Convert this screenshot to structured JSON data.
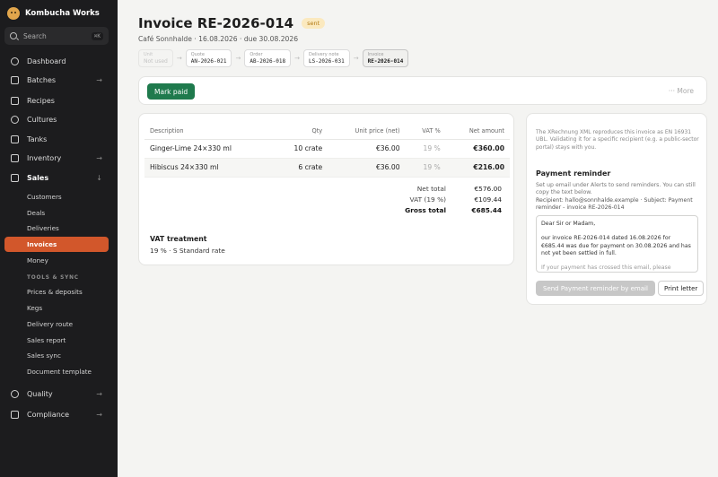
{
  "app": {
    "name": "Kombucha Works"
  },
  "search": {
    "label": "Search",
    "shortcut": "⌘K"
  },
  "nav": {
    "dashboard": "Dashboard",
    "batches": "Batches",
    "recipes": "Recipes",
    "cultures": "Cultures",
    "tanks": "Tanks",
    "inventory": "Inventory",
    "sales": "Sales",
    "quality": "Quality",
    "compliance": "Compliance",
    "chevron_right": "→",
    "chevron_down": "↓"
  },
  "sales_sub": {
    "customers": "Customers",
    "deals": "Deals",
    "deliveries": "Deliveries",
    "invoices": "Invoices",
    "money": "Money",
    "section": "TOOLS & SYNC",
    "prices": "Prices & deposits",
    "kegs": "Kegs",
    "route": "Delivery route",
    "report": "Sales report",
    "sync": "Sales sync",
    "template": "Document template"
  },
  "invoice": {
    "title": "Invoice RE-2026-014",
    "status": "sent",
    "subtitle": "Café Sonnhalde · 16.08.2026 · due 30.08.2026"
  },
  "chain": {
    "unit": {
      "k": "Unit",
      "v": "Not used"
    },
    "quote": {
      "k": "Quote",
      "v": "AN-2026-021"
    },
    "order": {
      "k": "Order",
      "v": "AB-2026-018"
    },
    "delivery": {
      "k": "Delivery note",
      "v": "LS-2026-031"
    },
    "invoice": {
      "k": "Invoice",
      "v": "RE-2026-014"
    },
    "arrow": "→"
  },
  "actions": {
    "mark_paid": "Mark paid",
    "more": "··· More"
  },
  "table": {
    "headers": {
      "description": "Description",
      "qty": "Qty",
      "unit_price": "Unit price (net)",
      "vat": "VAT %",
      "net": "Net amount"
    },
    "rows": [
      {
        "description": "Ginger-Lime 24×330 ml",
        "qty": "10 crate",
        "unit_price": "€36.00",
        "vat": "19 %",
        "net": "€360.00"
      },
      {
        "description": "Hibiscus 24×330 ml",
        "qty": "6 crate",
        "unit_price": "€36.00",
        "vat": "19 %",
        "net": "€216.00"
      }
    ]
  },
  "totals": {
    "net_label": "Net total",
    "net": "€576.00",
    "vat_label": "VAT (19 %)",
    "vat": "€109.44",
    "gross_label": "Gross total",
    "gross": "€685.44"
  },
  "vat_treatment": {
    "title": "VAT treatment",
    "value": "19 % · S Standard rate"
  },
  "side": {
    "note": "The XRechnung XML reproduces this invoice as EN 16931 UBL. Validating it for a specific recipient (e.g. a public-sector portal) stays with you.",
    "reminder_title": "Payment reminder",
    "reminder_help": "Set up email under Alerts to send reminders. You can still copy the text below.",
    "recipient": "Recipient: hallo@sonnhalde.example · Subject: Payment reminder - invoice RE-2026-014",
    "letter_greeting": "Dear Sir or Madam,",
    "letter_body": "our invoice RE-2026-014 dated 16.08.2026 for €685.44 was due for payment on 30.08.2026 and has not yet been settled in full.",
    "letter_more": "If your payment has crossed this email, please disregard",
    "send_button": "Send Payment reminder by email",
    "print_button": "Print letter"
  }
}
